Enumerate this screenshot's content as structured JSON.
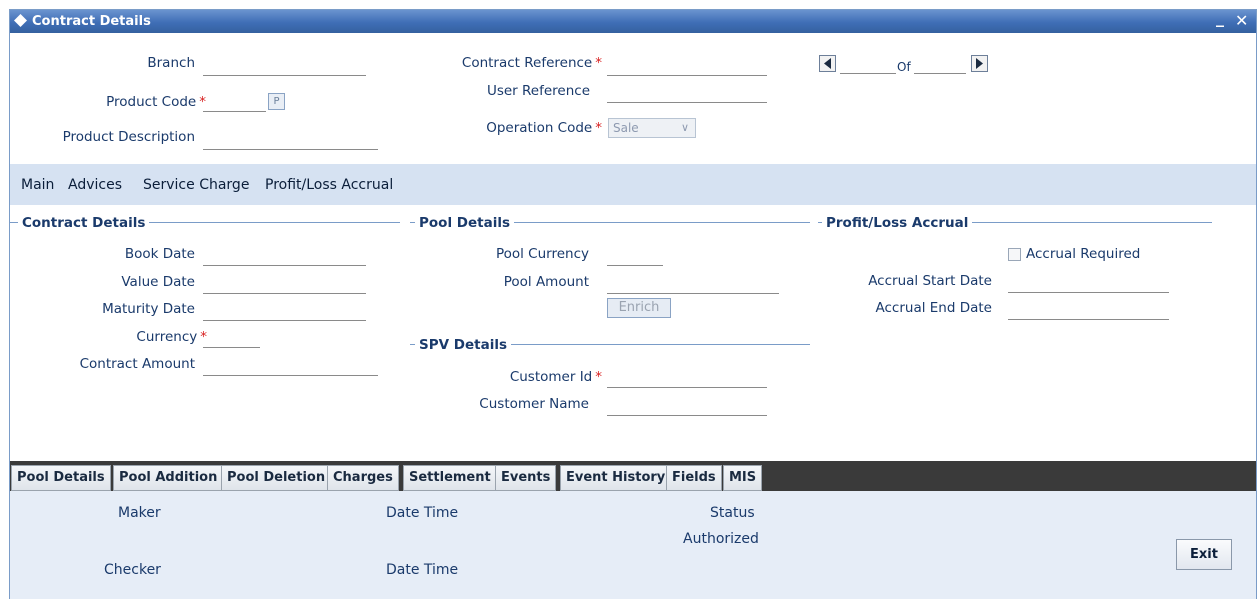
{
  "window": {
    "title": "Contract Details",
    "minimize_label": "_",
    "close_label": "✕"
  },
  "header": {
    "branch_label": "Branch",
    "product_code_label": "Product Code",
    "product_button_label": "P",
    "product_description_label": "Product Description",
    "contract_reference_label": "Contract Reference",
    "user_reference_label": "User Reference",
    "operation_code_label": "Operation Code",
    "operation_code_value": "Sale",
    "of_label": "Of",
    "required_marker": "*"
  },
  "tabs": [
    "Main",
    "Advices",
    "Service Charge",
    "Profit/Loss Accrual"
  ],
  "contract_details": {
    "heading": "Contract Details",
    "book_date_label": "Book Date",
    "value_date_label": "Value Date",
    "maturity_date_label": "Maturity Date",
    "currency_label": "Currency",
    "contract_amount_label": "Contract Amount"
  },
  "pool_details": {
    "heading": "Pool Details",
    "pool_currency_label": "Pool Currency",
    "pool_amount_label": "Pool Amount",
    "enrich_label": "Enrich"
  },
  "spv_details": {
    "heading": "SPV Details",
    "customer_id_label": "Customer Id",
    "customer_name_label": "Customer Name"
  },
  "profit_loss": {
    "heading": "Profit/Loss Accrual",
    "accrual_required_label": "Accrual Required",
    "accrual_start_label": "Accrual Start Date",
    "accrual_end_label": "Accrual End Date"
  },
  "bottom_tabs": [
    "Pool Details",
    "Pool Addition",
    "Pool Deletion",
    "Charges",
    "Settlement",
    "Events",
    "Event History",
    "Fields",
    "MIS"
  ],
  "audit": {
    "maker_label": "Maker",
    "checker_label": "Checker",
    "date_time_label": "Date Time",
    "status_label": "Status",
    "authorized_label": "Authorized",
    "exit_label": "Exit"
  }
}
